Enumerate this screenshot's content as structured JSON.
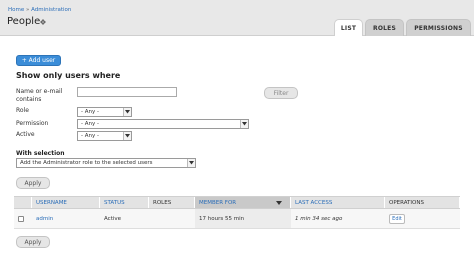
{
  "header": {
    "breadcrumb": [
      "Home",
      "Administration"
    ],
    "breadcrumb_sep": "»",
    "title": "People",
    "title_icon": "gear-icon",
    "tabs": [
      {
        "label": "LIST",
        "active": true
      },
      {
        "label": "ROLES",
        "active": false
      },
      {
        "label": "PERMISSIONS",
        "active": false
      }
    ]
  },
  "actions": {
    "add_user": "+ Add user"
  },
  "filters": {
    "title": "Show only users where",
    "name_label": "Name or e-mail contains",
    "name_value": "",
    "role_label": "Role",
    "role_value": "- Any -",
    "permission_label": "Permission",
    "permission_value": "- Any -",
    "active_label": "Active",
    "active_value": "- Any -",
    "filter_button": "Filter"
  },
  "bulk": {
    "title": "With selection",
    "action_value": "Add the Administrator role to the selected users",
    "apply": "Apply"
  },
  "table": {
    "columns": [
      "",
      "USERNAME",
      "STATUS",
      "ROLES",
      "MEMBER FOR",
      "LAST ACCESS",
      "OPERATIONS"
    ],
    "sorted_column": "MEMBER FOR",
    "rows": [
      {
        "username": "admin",
        "status": "Active",
        "roles": "",
        "member_for": "17 hours 55 min",
        "last_access": "1 min 34 sec ago",
        "operation": "Edit"
      }
    ]
  },
  "footer": {
    "apply": "Apply"
  },
  "colors": {
    "accent": "#3b8dd8",
    "link": "#2a6db8",
    "header_bg": "#e8e8e8"
  }
}
